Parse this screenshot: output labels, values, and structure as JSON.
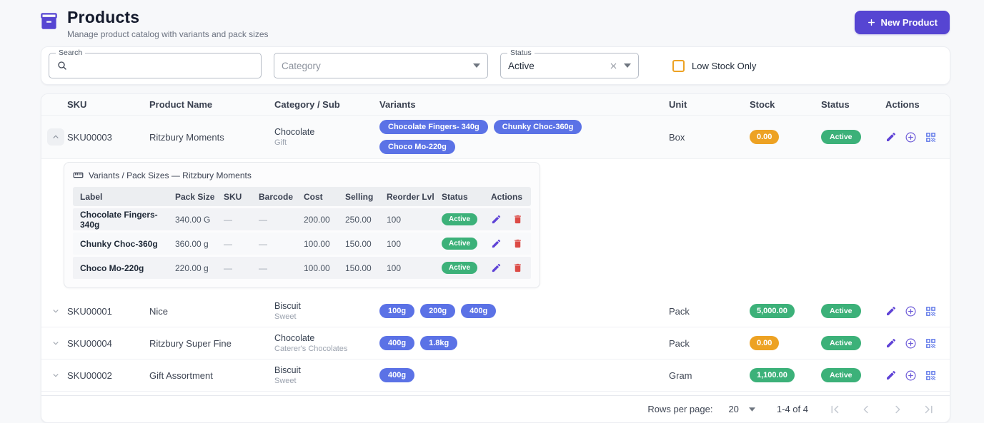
{
  "header": {
    "title": "Products",
    "subtitle": "Manage product catalog with variants and pack sizes",
    "new_product_label": "New Product"
  },
  "filters": {
    "search_label": "Search",
    "search_value": "",
    "category_placeholder": "Category",
    "status_label": "Status",
    "status_value": "Active",
    "low_stock_label": "Low Stock Only"
  },
  "table": {
    "columns": [
      "SKU",
      "Product Name",
      "Category / Sub",
      "Variants",
      "Unit",
      "Stock",
      "Status",
      "Actions"
    ],
    "rows": [
      {
        "sku": "SKU00003",
        "name": "Ritzbury Moments",
        "category": "Chocolate",
        "sub": "Gift",
        "variants": [
          "Chocolate Fingers- 340g",
          "Chunky Choc-360g",
          "Choco Mo-220g"
        ],
        "unit": "Box",
        "stock": "0.00",
        "stock_state": "low",
        "status": "Active",
        "expanded": true
      },
      {
        "sku": "SKU00001",
        "name": "Nice",
        "category": "Biscuit",
        "sub": "Sweet",
        "variants": [
          "100g",
          "200g",
          "400g"
        ],
        "unit": "Pack",
        "stock": "5,000.00",
        "stock_state": "ok",
        "status": "Active",
        "expanded": false
      },
      {
        "sku": "SKU00004",
        "name": "Ritzbury Super Fine",
        "category": "Chocolate",
        "sub": "Caterer's Chocolates",
        "variants": [
          "400g",
          "1.8kg"
        ],
        "unit": "Pack",
        "stock": "0.00",
        "stock_state": "low",
        "status": "Active",
        "expanded": false
      },
      {
        "sku": "SKU00002",
        "name": "Gift Assortment",
        "category": "Biscuit",
        "sub": "Sweet",
        "variants": [
          "400g"
        ],
        "unit": "Gram",
        "stock": "1,100.00",
        "stock_state": "ok",
        "status": "Active",
        "expanded": false
      }
    ]
  },
  "variant_panel": {
    "title": "Variants / Pack Sizes — Ritzbury Moments",
    "columns": [
      "Label",
      "Pack Size",
      "SKU",
      "Barcode",
      "Cost",
      "Selling",
      "Reorder Lvl",
      "Status",
      "Actions"
    ],
    "rows": [
      {
        "label": "Chocolate Fingers- 340g",
        "pack_size": "340.00 G",
        "sku": "—",
        "barcode": "—",
        "cost": "200.00",
        "selling": "250.00",
        "reorder": "100",
        "status": "Active"
      },
      {
        "label": "Chunky Choc-360g",
        "pack_size": "360.00 g",
        "sku": "—",
        "barcode": "—",
        "cost": "100.00",
        "selling": "150.00",
        "reorder": "100",
        "status": "Active"
      },
      {
        "label": "Choco Mo-220g",
        "pack_size": "220.00 g",
        "sku": "—",
        "barcode": "—",
        "cost": "100.00",
        "selling": "150.00",
        "reorder": "100",
        "status": "Active"
      }
    ]
  },
  "pagination": {
    "rows_per_page_label": "Rows per page:",
    "rows_per_page_value": "20",
    "range_label": "1-4 of 4"
  },
  "colors": {
    "accent_purple": "#5645d2",
    "chip_blue": "#5b72e6",
    "status_green": "#3cb179",
    "warn_orange": "#eda223",
    "danger_red": "#dc4a45",
    "action_blue": "#5b74e8"
  }
}
